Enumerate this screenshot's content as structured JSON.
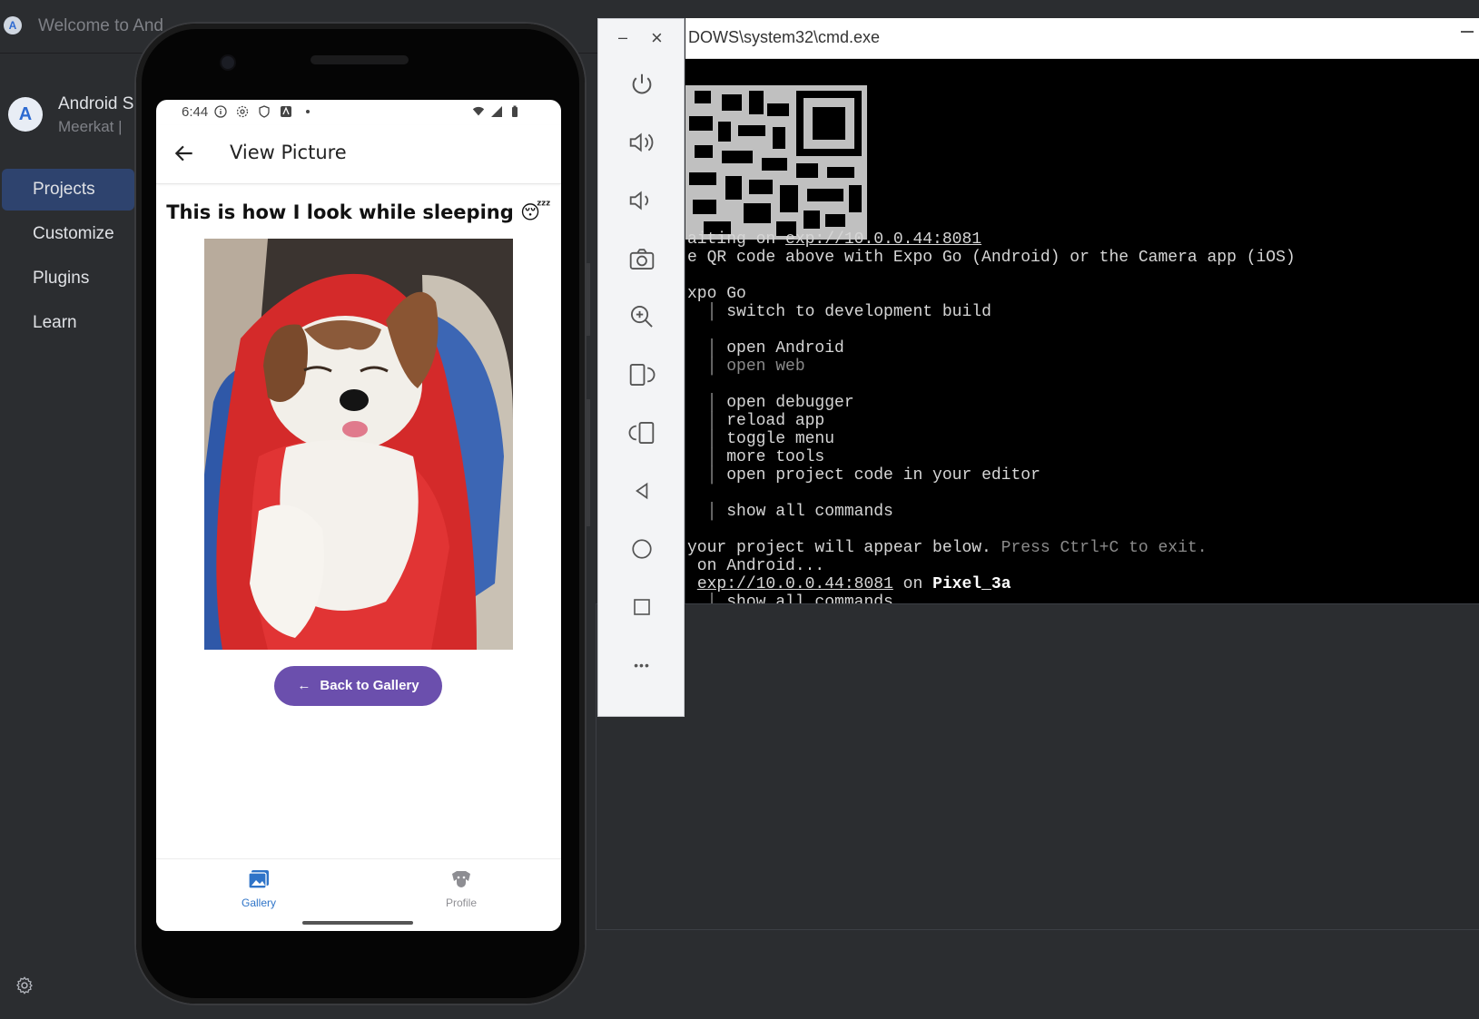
{
  "android_studio": {
    "window_title": "Welcome to And",
    "app_name": "Android S",
    "version": "Meerkat |",
    "nav": [
      "Projects",
      "Customize",
      "Plugins",
      "Learn"
    ],
    "active_nav": "Projects"
  },
  "emulator_toolbar": {
    "minimize": "–",
    "close": "×",
    "buttons": [
      "power-icon",
      "volume-up-icon",
      "volume-down-icon",
      "camera-icon",
      "zoom-icon",
      "rotate-left-icon",
      "rotate-right-icon",
      "back-icon",
      "home-icon",
      "overview-icon",
      "more-icon"
    ],
    "more_label": "•••"
  },
  "cmd": {
    "title": "DOWS\\system32\\cmd.exe",
    "lines": {
      "waiting_prefix": "aiting on ",
      "waiting_url": "exp://10.0.0.44:8081",
      "scan": "e QR code above with Expo Go (Android) or the Camera app (iOS)",
      "expo_go": "xpo Go",
      "switch": "switch to development build",
      "open_android": "open Android",
      "open_web": "open web",
      "open_debugger": "open debugger",
      "reload": "reload app",
      "toggle_menu": "toggle menu",
      "more_tools": "more tools",
      "open_code": "open project code in your editor",
      "show_all": "show all commands",
      "logs_prefix": "your project will appear below. ",
      "logs_exit": "Press Ctrl+C to exit.",
      "on_android": " on Android...",
      "opening_url": "exp://10.0.0.44:8081",
      "on_word": " on ",
      "device": "Pixel_3a",
      "show_all_2": "show all commands"
    }
  },
  "phone": {
    "status_time": "6:44",
    "header_title": "View Picture",
    "caption": "This is how I look while sleeping 😴",
    "back_button": "Back to Gallery",
    "tabs": [
      {
        "label": "Gallery",
        "active": true
      },
      {
        "label": "Profile",
        "active": false
      }
    ]
  },
  "colors": {
    "accent_nav": "#2e436e",
    "button_purple": "#6b4fad",
    "tab_active": "#2f74c8",
    "terminal_teal": "#36b5a8"
  }
}
